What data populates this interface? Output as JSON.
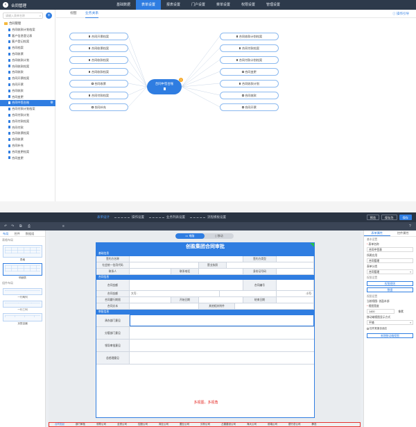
{
  "top": {
    "app_title": "合同管理",
    "nav": [
      "基础数据",
      "表单设置",
      "报表设置",
      "门户设置",
      "菜单设置",
      "权限设置",
      "管理设置"
    ],
    "nav_active_index": 1
  },
  "left": {
    "search_placeholder": "请输入表单名称",
    "root": "合同管理",
    "items": [
      "合同收款计划档案",
      "客户信息登记表",
      "客户登记档案",
      "合同档案",
      "合同收票",
      "合同收款计划",
      "合同收款档案",
      "合同收款",
      "合同开票档案",
      "合同开票",
      "合同收款",
      "合同变更",
      "合同付款计划档案",
      "合同付款计划",
      "合同付款档案",
      "合同付款",
      "合同收票档案",
      "合同收票",
      "合同补充",
      "合同变更档案",
      "合同变更"
    ],
    "selected_label": "合同中签台账"
  },
  "main": {
    "tabs": [
      "视图",
      "业务关系"
    ],
    "tab_active_index": 1,
    "guide": "操作引导",
    "center_node": "合同中签台账",
    "center_badge": "1",
    "left_nodes": [
      "合同开票档案",
      "合同收票档案",
      "合同收款档案",
      "合同收款档案",
      "合同收票",
      "合同付款档案",
      "合同补充"
    ],
    "right_nodes": [
      "合同收款计划档案",
      "合同付款档案",
      "合同付款计划档案",
      "合同变更",
      "合同收款计划",
      "合同收款",
      "合同开票"
    ]
  },
  "designer": {
    "steps": [
      "表单设计",
      "操作设置",
      "业务列表设置",
      "流程模板设置"
    ],
    "step_active_index": 0,
    "buttons": [
      "预览",
      "保存为",
      "保存"
    ],
    "left_tabs": [
      "布局",
      "控件",
      "数据组"
    ],
    "left_active_index": 0,
    "left_sections": [
      "表格布局",
      "组件布局"
    ],
    "comps": [
      "表格",
      "明细表",
      "一行两列",
      "一行三列",
      "页签容器"
    ],
    "view_toggle": [
      "电脑",
      "移动"
    ],
    "view_active_index": 0,
    "form_title": "创盈集团合同审批",
    "sections": [
      "基础信息",
      "合同信息",
      "审批信息"
    ],
    "rows_basic": [
      [
        "签约方名称",
        "",
        "签约方类型",
        ""
      ],
      [
        "社会统一信用代码",
        "",
        "营业执照",
        ""
      ],
      [
        "联系人",
        "",
        "联系电话",
        "",
        "身份证号码",
        ""
      ]
    ],
    "rows_contract": [
      [
        "合同金额",
        "",
        "合同编号",
        ""
      ],
      [
        "合同金额",
        "大写:",
        "",
        "小写:"
      ],
      [
        "合同履行期限",
        "",
        "开始日期",
        "",
        "结束日期",
        ""
      ],
      [
        "合同文本",
        "",
        "其他相关附件",
        ""
      ]
    ],
    "opinions": [
      "承办部门意见",
      "分管部门意见",
      "领导审批意见",
      "总经理意见"
    ],
    "multiview": "多视图，多视角",
    "bottom_tabs": [
      "合同发起",
      "部门审批",
      "领导公司",
      "全资公司",
      "控股公司",
      "商业公司",
      "置业公司",
      "分析公司",
      "占建建设公司",
      "海大公司",
      "前端公司",
      "银行总公司"
    ],
    "bottom_tabs_extra": "静态",
    "right_tabs": [
      "表单属性",
      "控件属性"
    ],
    "right_active_index": 0,
    "props": {
      "section1": "基本设置",
      "form_name_label": "表单名称",
      "form_name": "合同中签表",
      "app_label": "所属应用",
      "app_value": "合同管理",
      "category_label": "表单分类",
      "category_value": "合同管理",
      "section2": "权限设置",
      "perm_btn": "权限规则",
      "data_btn": "数据",
      "section3": "视图设置",
      "current_view_label": "当前视图:",
      "current_view": "创盈本部",
      "width_label": "视图宽度",
      "width_value": "1400",
      "width_unit": "像素",
      "mobile_label": "移动端视图显示方式",
      "mobile_value": "平铺",
      "check_label": "控件宽度自适应",
      "add_view_btn": "新增移动端视图"
    }
  }
}
